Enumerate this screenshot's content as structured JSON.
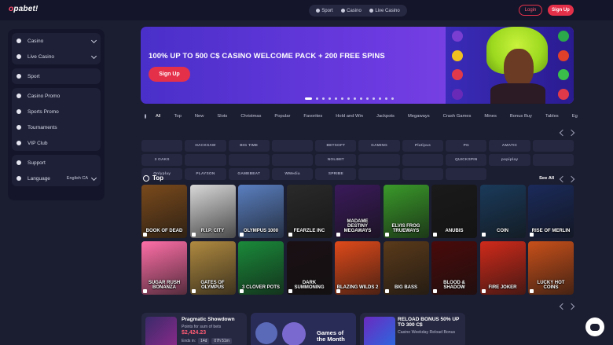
{
  "brand": {
    "logo_prefix": "o",
    "logo_rest": "pabet!"
  },
  "header": {
    "modes": [
      "Sport",
      "Casino",
      "Live Casino"
    ],
    "login_label": "Login",
    "signup_label": "Sign Up"
  },
  "sidebar": {
    "groups": [
      [
        {
          "label": "Casino",
          "icon": "casino-icon",
          "chevron": true
        },
        {
          "label": "Live Casino",
          "icon": "live-casino-icon",
          "chevron": true
        }
      ],
      [
        {
          "label": "Sport",
          "icon": "soccer-ball-icon"
        }
      ],
      [
        {
          "label": "Casino Promo",
          "icon": "star-icon"
        },
        {
          "label": "Sports Promo",
          "icon": "star-icon"
        },
        {
          "label": "Tournaments",
          "icon": "trophy-icon"
        },
        {
          "label": "VIP Club",
          "icon": "user-icon"
        }
      ],
      [
        {
          "label": "Support",
          "icon": "support-icon"
        },
        {
          "label": "Language",
          "icon": "globe-icon",
          "value": "English CA",
          "chevron": true
        }
      ]
    ]
  },
  "banner": {
    "title": "100% UP TO 500 C$ CASINO WELCOME PACK + 200 FREE SPINS",
    "cta_label": "Sign Up",
    "slides": 14,
    "active_slide": 0
  },
  "categories": [
    "All",
    "Top",
    "New",
    "Slots",
    "Christmas",
    "Popular",
    "Favorites",
    "Hold and Win",
    "Jackpots",
    "Megaways",
    "Crash Games",
    "Mines",
    "Bonus Buy",
    "Tables",
    "Eg"
  ],
  "providers": [
    "",
    "HACKSAW",
    "BIG TIME",
    "",
    "BETSOFT",
    "GAMING",
    "Platipus",
    "PG",
    "AMATIC",
    "",
    "3 OAKS",
    "",
    "",
    "",
    "NOLIMIT",
    "",
    "",
    "QUICKSPIN",
    "popiplay",
    "",
    "Onlyplay",
    "PLAYSON",
    "GAMEBEAT",
    "WMedia",
    "SPRIBE",
    "",
    "",
    ""
  ],
  "top_section": {
    "title": "Top",
    "see_all_label": "See All",
    "games": [
      {
        "title": "BOOK OF DEAD",
        "bg": "#7a4a1c"
      },
      {
        "title": "R.I.P. CITY",
        "bg": "#d8d8d8"
      },
      {
        "title": "OLYMPUS 1000",
        "bg": "#5a7fc0"
      },
      {
        "title": "FEARZLE INC",
        "bg": "#2a2a2a"
      },
      {
        "title": "MADAME DESTINY MEGAWAYS",
        "bg": "#3a1a5a"
      },
      {
        "title": "ELVIS FROG TRUEWAYS",
        "bg": "#3a9a2a"
      },
      {
        "title": "ANUBIS",
        "bg": "#1a1a1a"
      },
      {
        "title": "COIN",
        "bg": "#1a3a5a"
      },
      {
        "title": "RISE OF MERLIN",
        "bg": "#1a2a5a"
      },
      {
        "title": "SUGAR RUSH BONANZA",
        "bg": "#ff6fa8"
      },
      {
        "title": "GATES OF OLYMPUS",
        "bg": "#b08a40"
      },
      {
        "title": "3 CLOVER POTS",
        "bg": "#1a8a3a"
      },
      {
        "title": "DARK SUMMONING",
        "bg": "#1a1014"
      },
      {
        "title": "BLAZING WILDS 2",
        "bg": "#e04a1a"
      },
      {
        "title": "BIG BASS",
        "bg": "#5a3a1a"
      },
      {
        "title": "BLOOD & SHADOW",
        "bg": "#4a0a0a"
      },
      {
        "title": "FIRE JOKER",
        "bg": "#d02a1a"
      },
      {
        "title": "LUCKY HOT COINS",
        "bg": "#c8501a"
      }
    ]
  },
  "promos": [
    {
      "title": "Pragmatic Showdown",
      "sub": "Points for sum of bets",
      "prize": "$2,424.23",
      "ends_label": "Ends in:",
      "ends_days": "14d",
      "ends_time": "07h 51m"
    },
    {
      "title": "Games of the Month"
    },
    {
      "title": "RELOAD BONUS 50% UP TO 300 C$",
      "sub": "Casino Weekday Reload Bonus"
    }
  ],
  "colors": {
    "accent": "#e5304a",
    "bg": "#1b1d30",
    "panel": "#14152a"
  }
}
